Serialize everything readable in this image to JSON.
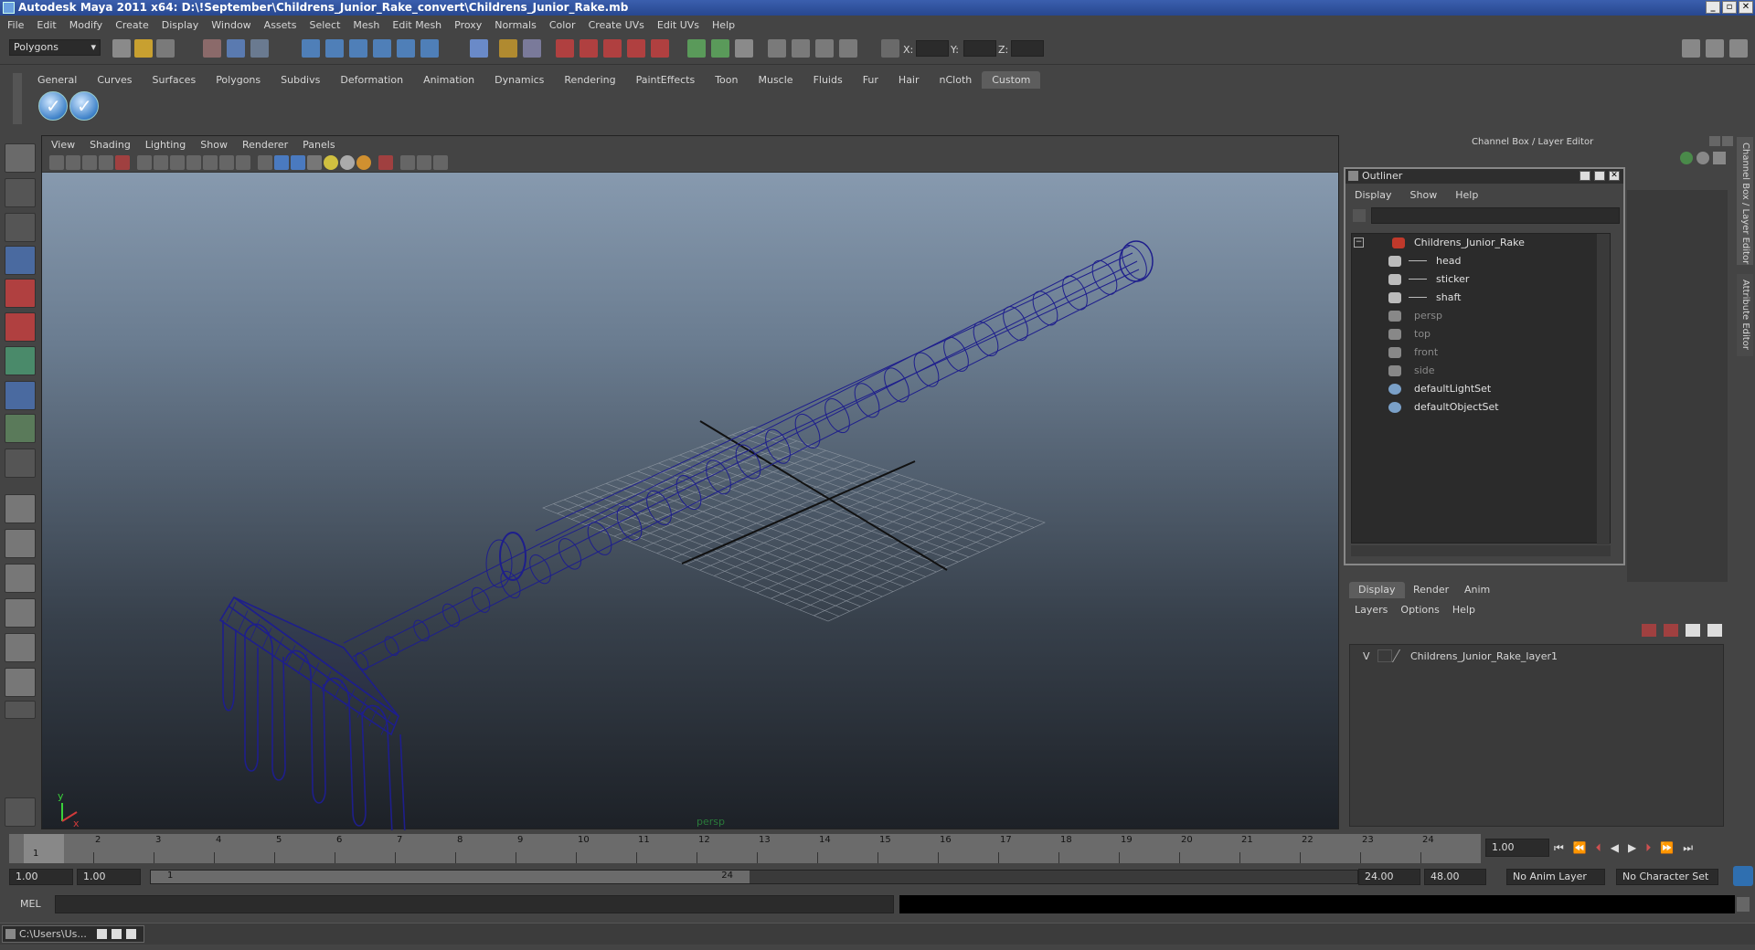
{
  "window": {
    "title": "Autodesk Maya 2011 x64: D:\\!September\\Childrens_Junior_Rake_convert\\Childrens_Junior_Rake.mb",
    "buttons": [
      "_",
      "▫",
      "✕"
    ]
  },
  "menubar": [
    "File",
    "Edit",
    "Modify",
    "Create",
    "Display",
    "Window",
    "Assets",
    "Select",
    "Mesh",
    "Edit Mesh",
    "Proxy",
    "Normals",
    "Color",
    "Create UVs",
    "Edit UVs",
    "Help"
  ],
  "statusline": {
    "mode": "Polygons",
    "coord_labels": [
      "X:",
      "Y:",
      "Z:"
    ]
  },
  "shelf": {
    "tabs": [
      "General",
      "Curves",
      "Surfaces",
      "Polygons",
      "Subdivs",
      "Deformation",
      "Animation",
      "Dynamics",
      "Rendering",
      "PaintEffects",
      "Toon",
      "Muscle",
      "Fluids",
      "Fur",
      "Hair",
      "nCloth",
      "Custom"
    ],
    "active_tab": "Custom"
  },
  "viewport": {
    "menu": [
      "View",
      "Shading",
      "Lighting",
      "Show",
      "Renderer",
      "Panels"
    ],
    "camera_label": "persp",
    "axis_x": "x",
    "axis_y": "y",
    "mesh_color": "#1e1e8c"
  },
  "right_panel": {
    "header": "Channel Box / Layer Editor",
    "side_tabs": [
      "Channel Box / Layer Editor",
      "Attribute Editor"
    ]
  },
  "outliner": {
    "title": "Outliner",
    "menu": [
      "Display",
      "Show",
      "Help"
    ],
    "items": [
      {
        "label": "Childrens_Junior_Rake",
        "level": 0,
        "dim": false,
        "icon": "transform-icon"
      },
      {
        "label": "head",
        "level": 1,
        "dim": false,
        "icon": "mesh-icon"
      },
      {
        "label": "sticker",
        "level": 1,
        "dim": false,
        "icon": "mesh-icon"
      },
      {
        "label": "shaft",
        "level": 1,
        "dim": false,
        "icon": "mesh-icon"
      },
      {
        "label": "persp",
        "level": 0,
        "dim": true,
        "icon": "camera-icon"
      },
      {
        "label": "top",
        "level": 0,
        "dim": true,
        "icon": "camera-icon"
      },
      {
        "label": "front",
        "level": 0,
        "dim": true,
        "icon": "camera-icon"
      },
      {
        "label": "side",
        "level": 0,
        "dim": true,
        "icon": "camera-icon"
      },
      {
        "label": "defaultLightSet",
        "level": 0,
        "dim": false,
        "icon": "set-icon"
      },
      {
        "label": "defaultObjectSet",
        "level": 0,
        "dim": false,
        "icon": "set-icon"
      }
    ]
  },
  "layer_editor": {
    "tabs": [
      "Display",
      "Render",
      "Anim"
    ],
    "active_tab": "Display",
    "menu": [
      "Layers",
      "Options",
      "Help"
    ],
    "layers": [
      {
        "visible": "V",
        "name": "Childrens_Junior_Rake_layer1"
      }
    ]
  },
  "timeline": {
    "ticks": [
      "1",
      "2",
      "3",
      "4",
      "5",
      "6",
      "7",
      "8",
      "9",
      "10",
      "11",
      "12",
      "13",
      "14",
      "15",
      "16",
      "17",
      "18",
      "19",
      "20",
      "21",
      "22",
      "23",
      "24"
    ],
    "current_frame": "1",
    "current_time": "1.00"
  },
  "range": {
    "start": "1.00",
    "playback_start": "1.00",
    "slider_start": "1",
    "slider_end": "24",
    "playback_end": "24.00",
    "end": "48.00",
    "anim_layer": "No Anim Layer",
    "character_set": "No Character Set"
  },
  "mel": {
    "label": "MEL"
  },
  "taskbar": {
    "item": "C:\\Users\\Us..."
  }
}
